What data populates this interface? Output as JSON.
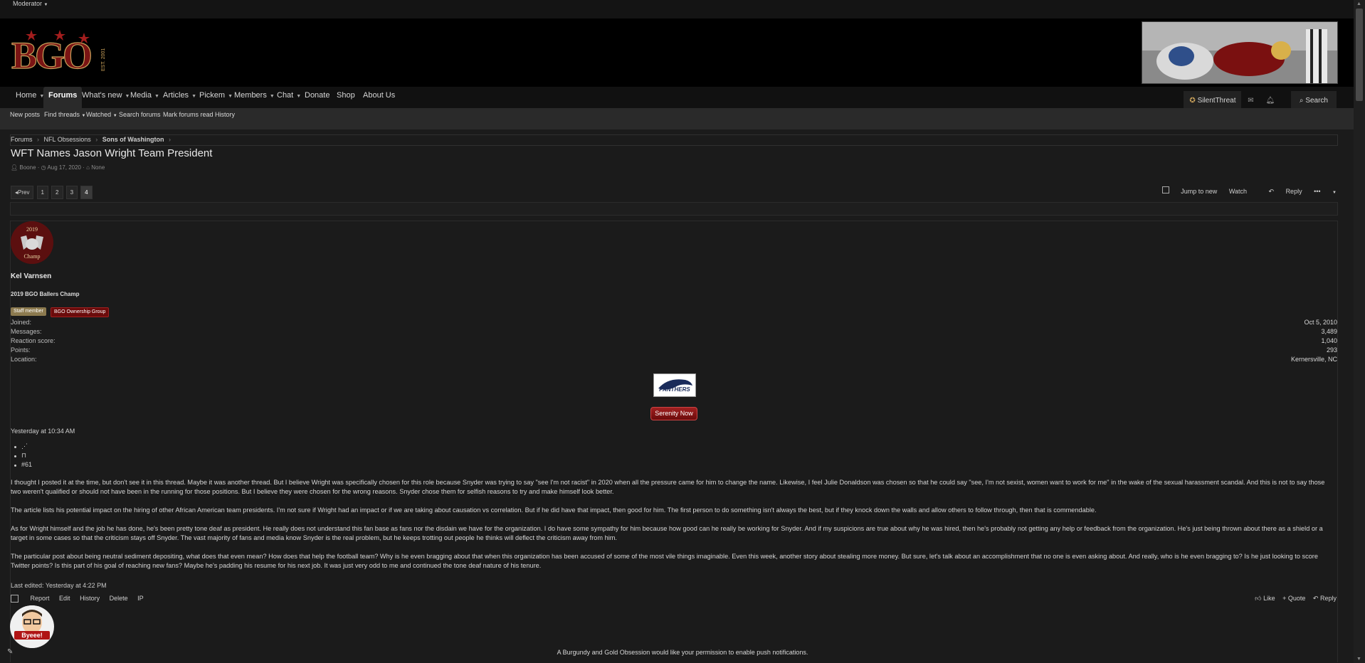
{
  "topbar": {
    "moderator": "Moderator"
  },
  "logo": {
    "text": "BGO",
    "est": "EST. 2001"
  },
  "nav": {
    "items": [
      {
        "label": "Home",
        "caret": true
      },
      {
        "label": "Forums",
        "caret": false,
        "active": true
      },
      {
        "label": "What's new",
        "caret": true
      },
      {
        "label": "Media",
        "caret": true
      },
      {
        "label": "Articles",
        "caret": true
      },
      {
        "label": "Pickem",
        "caret": true
      },
      {
        "label": "Members",
        "caret": true
      },
      {
        "label": "Chat",
        "caret": true
      },
      {
        "label": "Donate",
        "caret": false
      },
      {
        "label": "Shop",
        "caret": false
      },
      {
        "label": "About Us",
        "caret": false
      }
    ],
    "username": "SilentThreat",
    "search": "Search"
  },
  "subnav": {
    "items": [
      "New posts",
      "Find threads",
      "Watched",
      "Search forums",
      "Mark forums read",
      "History"
    ]
  },
  "breadcrumb": [
    "Forums",
    "NFL Obsessions",
    "Sons of Washington"
  ],
  "thread": {
    "title": "WFT Names Jason Wright Team President",
    "author": "Boone",
    "date": "Aug 17, 2020",
    "tags": "None"
  },
  "pager": {
    "prev": "Prev",
    "pages": [
      "1",
      "2",
      "3",
      "4"
    ],
    "current": "4"
  },
  "thread_actions": {
    "jump": "Jump to new",
    "watch": "Watch",
    "reply": "Reply"
  },
  "post": {
    "avatar_text_top": "2019",
    "avatar_text_bottom": "Champ",
    "username": "Kel Varnsen",
    "user_title": "2019 BGO Ballers Champ",
    "badges": [
      "Staff member",
      "BGO Ownership Group"
    ],
    "stats": [
      {
        "label": "Joined:",
        "value": "Oct 5, 2010"
      },
      {
        "label": "Messages:",
        "value": "3,489"
      },
      {
        "label": "Reaction score:",
        "value": "1,040"
      },
      {
        "label": "Points:",
        "value": "293"
      },
      {
        "label": "Location:",
        "value": "Kernersville, NC"
      }
    ],
    "sig_logo": "PANTHERS",
    "sig_button": "Serenity Now",
    "date": "Yesterday at 10:34 AM",
    "number": "#61",
    "paragraphs": [
      "I thought I posted it at the time, but don't see it in this thread. Maybe it was another thread. But I believe Wright was specifically chosen for this role because Snyder was trying to say \"see I'm not racist\" in 2020 when all the pressure came for him to change the name. Likewise, I feel Julie Donaldson was chosen so that he could say \"see, I'm not sexist, women want to work for me\" in the wake of the sexual harassment scandal. And this is not to say those two weren't qualified or should not have been in the running for those positions. But I believe they were chosen for the wrong reasons. Snyder chose them for selfish reasons to try and make himself look better.",
      "The article lists his potential impact on the hiring of other African American team presidents. I'm not sure if Wright had an impact or if we are taking about causation vs correlation. But if he did have that impact, then good for him. The first person to do something isn't always the best, but if they knock down the walls and allow others to follow through, then that is commendable.",
      "As for Wright himself and the job he has done, he's been pretty tone deaf as president. He really does not understand this fan base as fans nor the disdain we have for the organization. I do have some sympathy for him because how good can he really be working for Snyder. And if my suspicions are true about why he was hired, then he's probably not getting any help or feedback from the organization. He's just being thrown about there as a shield or a target in some cases so that the criticism stays off Snyder. The vast majority of fans and media know Snyder is the real problem, but he keeps trotting out people he thinks will deflect the criticism away from him.",
      "The particular post about being neutral sediment depositing, what does that even mean? How does that help the football team? Why is he even bragging about that when this organization has been accused of some of the most vile things imaginable. Even this week, another story about stealing more money. But sure, let's talk about an accomplishment that no one is even asking about. And really, who is he even bragging to? Is he just looking to score Twitter points? Is this part of his goal of reaching new fans? Maybe he's padding his resume for his next job. It was just very odd to me and continued the tone deaf nature of his tenure."
    ],
    "last_edited": "Last edited: Yesterday at 4:22 PM",
    "actions_left": [
      "Report",
      "Edit",
      "History",
      "Delete",
      "IP"
    ],
    "actions_right": [
      "Like",
      "Quote",
      "Reply"
    ]
  },
  "next_avatar_label": "Byeee!",
  "push_notice": "A Burgundy and Gold Obsession would like your permission to enable push notifications.",
  "colors": {
    "staff_badge": "#8c7a4f",
    "group_badge": "#6b0b0b",
    "header_bg": "#000000",
    "page_bg": "#1b1b1b"
  }
}
